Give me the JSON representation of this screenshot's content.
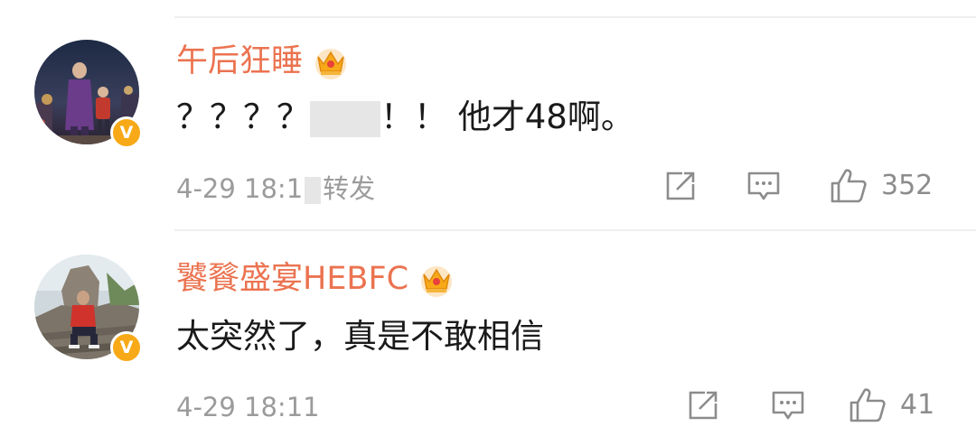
{
  "comments": [
    {
      "username": "午后狂睡",
      "text_start": "？？？？",
      "text_end": "！！ 他才48啊。",
      "date": "4-29 18:1",
      "repost_label": "转发",
      "likes": "352",
      "verified_badge": "V",
      "icons": [
        "crown-icon",
        "repost-icon",
        "comment-icon",
        "like-icon"
      ]
    },
    {
      "username": "饕餮盛宴HEBFC",
      "text": "太突然了，真是不敢相信",
      "date": "4-29 18:11",
      "likes": "41",
      "verified_badge": "V",
      "icons": [
        "crown-icon",
        "repost-icon",
        "comment-icon",
        "like-icon"
      ]
    }
  ],
  "colors": {
    "username": "#eb7350",
    "text": "#1a1a1a",
    "meta": "#9b9b9b",
    "badge": "#f7a917",
    "divider": "#efefef"
  }
}
